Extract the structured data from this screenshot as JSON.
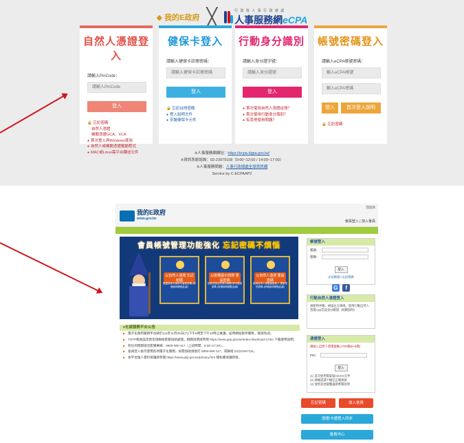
{
  "ecpa": {
    "logo_gov": "我的E政府",
    "logo_x": "╳",
    "logo_cpa_small": "行 政 院 人 事 行 政 總 處",
    "logo_cpa_main": "人事服務網",
    "logo_cpa_brand": "eCPA",
    "cards": [
      {
        "title": "自然人憑證登入",
        "label": "請輸入PinCode：",
        "placeholder": "請輸入PinCode",
        "button": "登入",
        "links": [
          "忘記密碼",
          "自然人憑證",
          "機關憑證GCA、XCA",
          "首次登入與Windows使用",
          "自然人或機關憑證驅動程式",
          "MAC或Linux需平台轉送元件"
        ],
        "color": "#e46a5e"
      },
      {
        "title": "健保卡登入",
        "label": "請輸入健保卡註冊密碼：",
        "placeholder": "請輸入健保卡註冊密碼",
        "button": "登入",
        "links": [
          "忘記註冊密碼",
          "登入說明文件",
          "安裝健保卡元件"
        ],
        "color": "#2aa8da"
      },
      {
        "title": "行動身分識別",
        "label": "請輸入身分證字號：",
        "placeholder": "請輸入身分證號",
        "button": "登入",
        "links": [
          "首次使用自然人憑證註冊？",
          "首次使用行動身分識別？",
          "有其他使用問題？"
        ],
        "color": "#e3266e"
      },
      {
        "title": "帳號密碼登入",
        "label": "請輸入eCPA帳號密碼：",
        "placeholder": "輸入eCPA帳號",
        "placeholder2": "輸入eCPA密碼",
        "button": "登入",
        "button2": "首次登入說明",
        "links": [
          "忘記密碼"
        ],
        "color": "#eca53a"
      }
    ],
    "footer": {
      "line1_prefix": "※人事服務網網址：",
      "line1_link": "https://ecpa.dgpa.gov.tw/",
      "line2": "※資訊系統諮詢：02-23979108（9:00~12:00 / 14:00~17:00）",
      "line3_prefix": "※人事服務問題：",
      "line3_link": "人事行政總處全球資訊網",
      "line4": "Service by C-ECPAAP2"
    }
  },
  "gov": {
    "logo_name": "我的E政府",
    "logo_url": "www.gov.tw",
    "top_right": "回首頁",
    "top_links": "會員登入 | 加入會員",
    "banner_title_a": "會員帳號管理功能強化 ",
    "banner_title_b": "忘記密碼不煩惱",
    "banner_boxes": [
      {
        "caption": "以自然人憑證\n忘記密碼",
        "text": "驗證其身分後即可重設密碼\n(詳細說明請點此處)"
      },
      {
        "caption": "以密碼提示問題\n重設密碼",
        "text": "回答您設定的提示問題\n即可重設密碼\n(詳細說明請點此處)"
      },
      {
        "caption": "以自然人憑證\n重設密碼",
        "text": "使用自然人憑證直接登入\n重設您的密碼\n(詳細說明請點此處)"
      }
    ],
    "news_header": "e化就服務平台公告",
    "news": [
      "電子化政府服務平台將於111年11月26日(六)下午5時至下午10時止維護，屆時網站暫停服務，敬請見諒。",
      "TOTP帳號設定異常請聯絡客服協助處理，相關說明請參閱 https://www.gsp.gov.tw/index-download-2.htm 下載使用說明。",
      "有任何問題請洽客服專線：0800-080-117（上班時間：8:30~17:30）。",
      "會員登入後可使用各項電子化服務，如需協助請撥打 0800-080-117，或聯絡 (02)21927111。",
      "本平台個人資料保護請參閱 https://www.gsp.gov.tw/privacy.htm 隱私權保護政策。"
    ],
    "login_title": "帳號登入",
    "login_account": "帳號：",
    "login_password": "密碼：",
    "login_button": "登入",
    "login_links": "忘記帳號 | 忘記密碼",
    "cert_title": "行動自然人憑證登入",
    "cert_text": "請使用手機，掃描左方條碼，使用行動自然人憑證App完成身分驗證（相關說明）",
    "pin_title": "憑證登入",
    "pin_text": "請插入自然人憑證並輸入PIN碼(6~8碼)",
    "pin_label": "PIN：",
    "pin_button": "登入",
    "pin_notes": "(1) 首次使用需安裝HiCOS元件\n(2) 請確認讀卡機已正確連接\n(3) 使用其他瀏覽器請參閱說明",
    "btn_forgot": "忘記密碼",
    "btn_join": "加入會員",
    "btn_cert": "憑證/卡證登入同步",
    "btn_center": "會員中心"
  }
}
